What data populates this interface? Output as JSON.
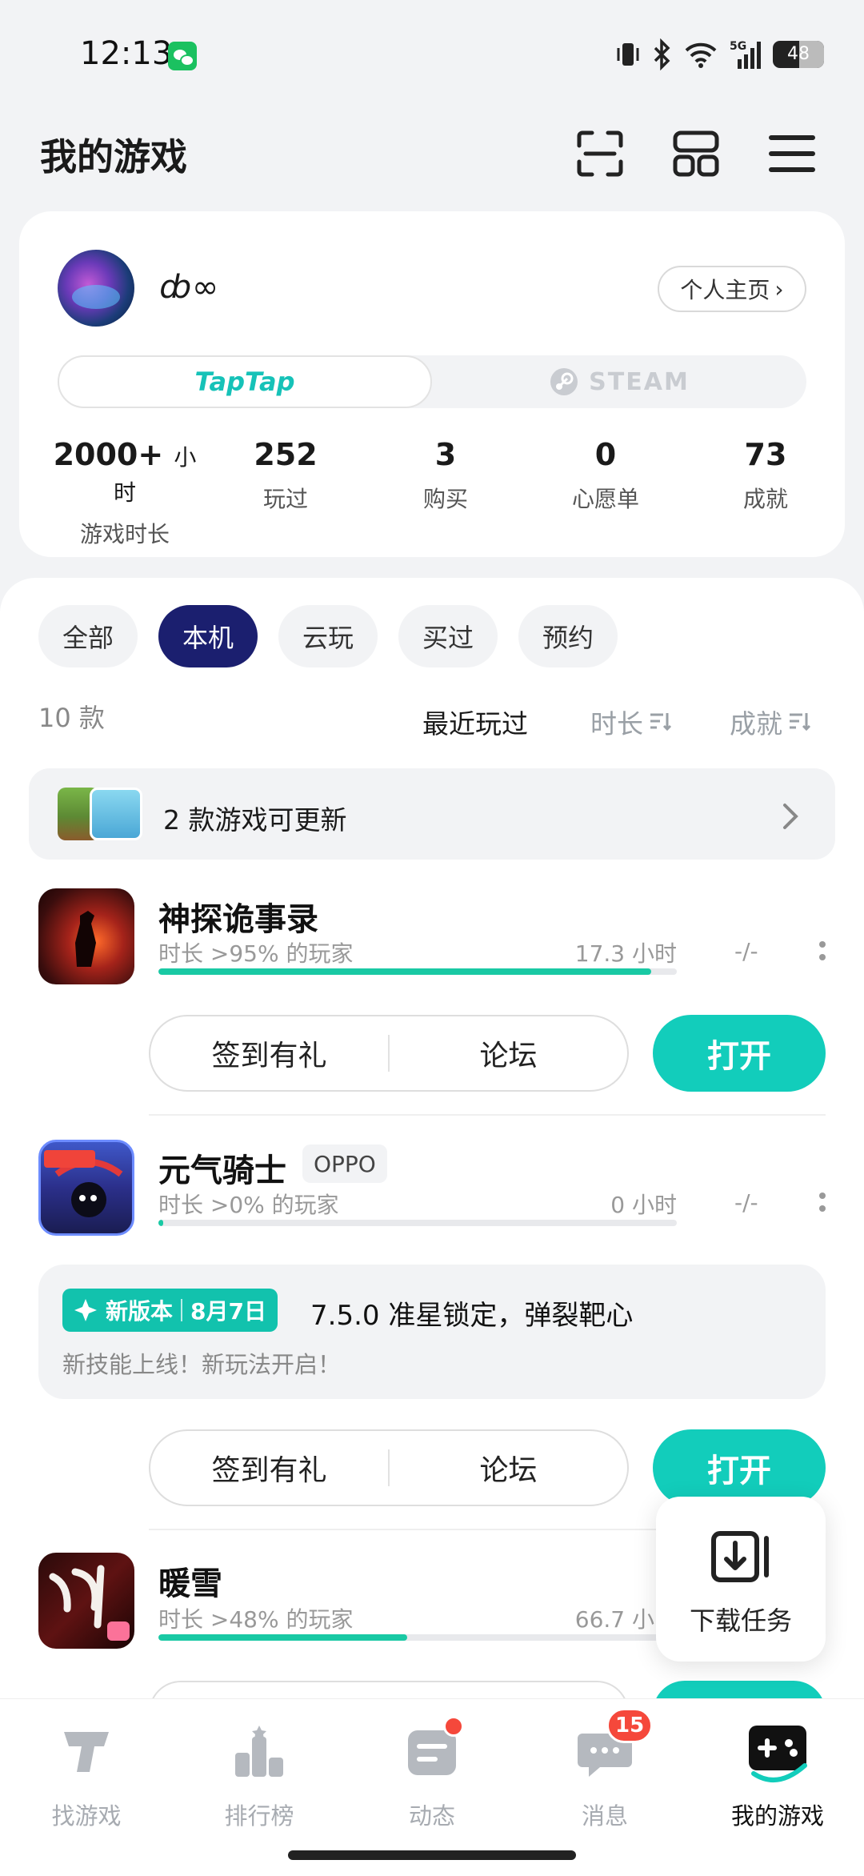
{
  "status_bar": {
    "time": "12:13",
    "battery": "48"
  },
  "header": {
    "title": "我的游戏"
  },
  "profile": {
    "username": "ȸ∞",
    "homepage_label": "个人主页",
    "platform_tabs": [
      "TapTap",
      "STEAM"
    ],
    "active_platform": "TapTap",
    "stats": [
      {
        "value": "2000+",
        "unit": "小时",
        "label": "游戏时长"
      },
      {
        "value": "252",
        "label": "玩过"
      },
      {
        "value": "3",
        "label": "购买"
      },
      {
        "value": "0",
        "label": "心愿单"
      },
      {
        "value": "73",
        "label": "成就"
      }
    ]
  },
  "filters": {
    "items": [
      "全部",
      "本机",
      "云玩",
      "买过",
      "预约"
    ],
    "active": "本机"
  },
  "list_meta": {
    "count": "10 款",
    "sort": [
      "最近玩过",
      "时长",
      "成就"
    ],
    "active_sort": "最近玩过"
  },
  "update_bar": {
    "text": "2 款游戏可更新"
  },
  "games": [
    {
      "name": "神探诡事录",
      "subtitle": "时长 >95% 的玩家",
      "hours": "17.3 小时",
      "progress": 0.95,
      "rating": "-/-",
      "btn_left": "签到有礼",
      "btn_right": "论坛",
      "open_label": "打开"
    },
    {
      "name": "元气骑士",
      "tag": "OPPO",
      "subtitle": "时长 >0% 的玩家",
      "hours": "0 小时",
      "progress": 0.01,
      "rating": "-/-",
      "btn_left": "签到有礼",
      "btn_right": "论坛",
      "open_label": "打开",
      "news": {
        "badge": "新版本",
        "date": "8月7日",
        "title": "7.5.0 准星锁定，弹裂靶心",
        "desc": "新技能上线！新玩法开启！"
      }
    },
    {
      "name": "暖雪",
      "subtitle": "时长 >48% 的玩家",
      "hours": "66.7 小时",
      "progress": 0.48
    }
  ],
  "download_float": {
    "label": "下载任务"
  },
  "bottom_nav": {
    "items": [
      "找游戏",
      "排行榜",
      "动态",
      "消息",
      "我的游戏"
    ],
    "active": "我的游戏",
    "message_badge": "15"
  },
  "colors": {
    "accent": "#12cdbb",
    "active_chip": "#1b1f6f",
    "badge_red": "#f5483b"
  }
}
